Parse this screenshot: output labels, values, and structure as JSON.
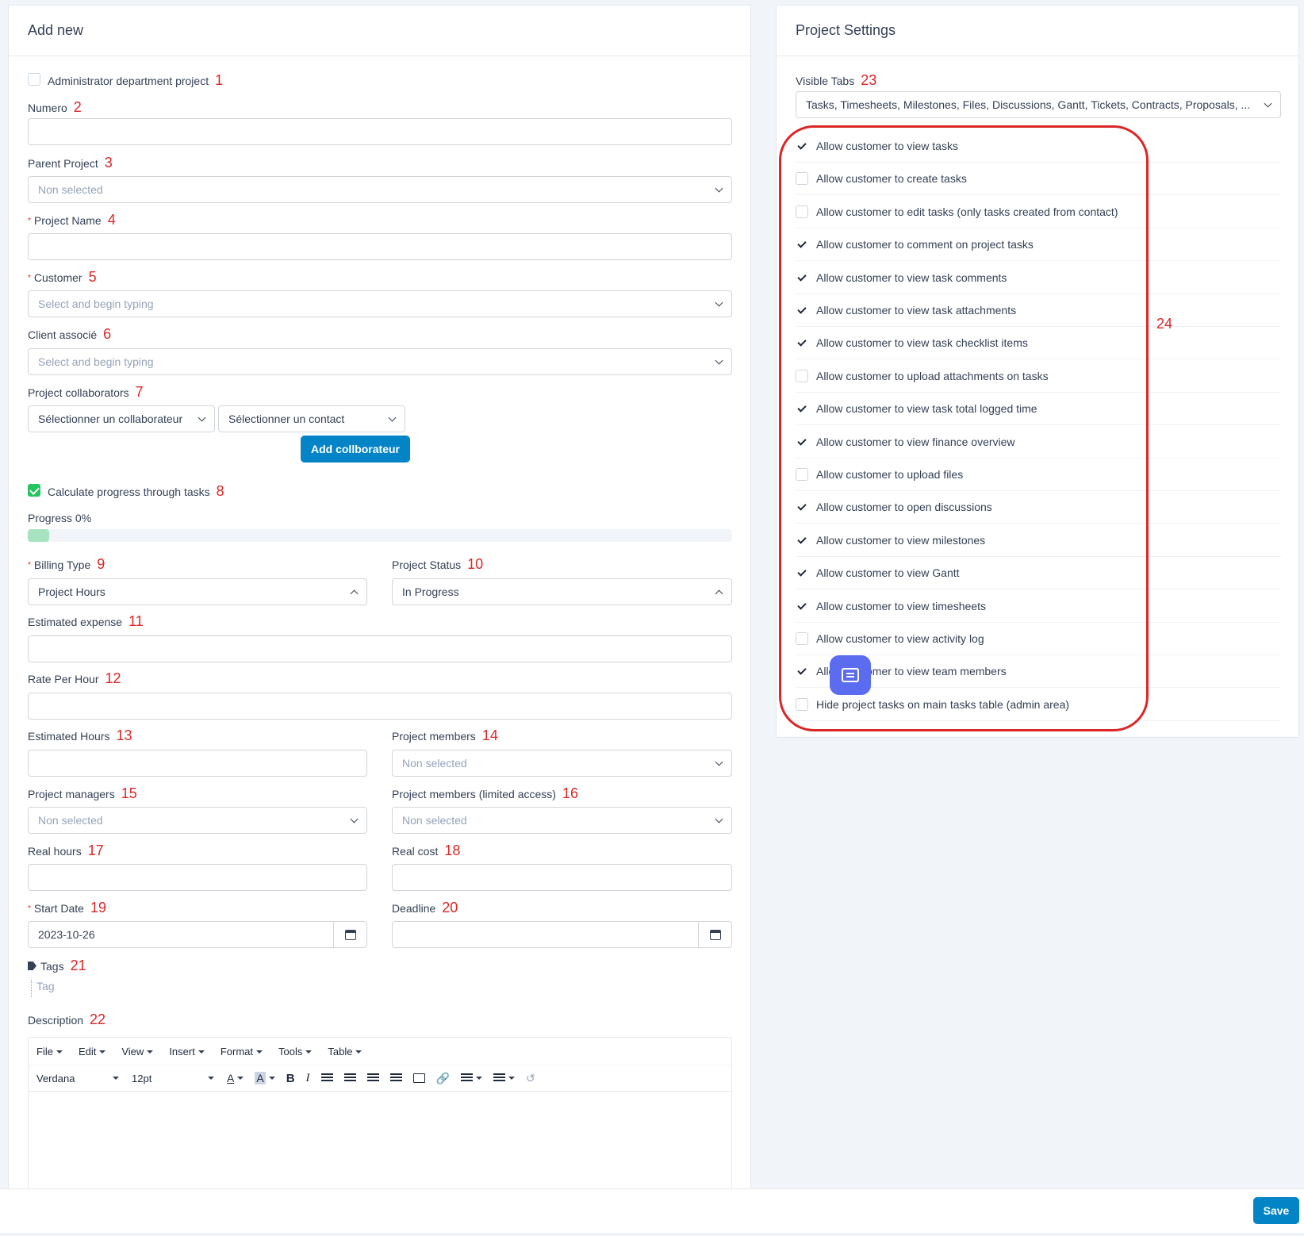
{
  "left": {
    "title": "Add new",
    "admin_dept": {
      "label": "Administrator department project",
      "anno": "1"
    },
    "numero": {
      "label": "Numero",
      "anno": "2",
      "value": ""
    },
    "parent_project": {
      "label": "Parent Project",
      "anno": "3",
      "placeholder": "Non selected"
    },
    "project_name": {
      "required": "*",
      "label": "Project Name",
      "anno": "4",
      "value": ""
    },
    "customer": {
      "required": "*",
      "label": "Customer",
      "anno": "5",
      "placeholder": "Select and begin typing"
    },
    "client_associe": {
      "label": "Client associé",
      "anno": "6",
      "placeholder": "Select and begin typing"
    },
    "collaborators": {
      "label": "Project collaborators",
      "anno": "7",
      "select_collab": "Sélectionner un collaborateur",
      "select_contact": "Sélectionner un contact",
      "add_button": "Add collborateur"
    },
    "calc_progress": {
      "label": "Calculate progress through tasks",
      "anno": "8",
      "checked": true
    },
    "progress": {
      "label": "Progress 0%",
      "value": 0.03
    },
    "billing_type": {
      "required": "*",
      "label": "Billing Type",
      "anno": "9",
      "value": "Project Hours"
    },
    "project_status": {
      "label": "Project Status",
      "anno": "10",
      "value": "In Progress"
    },
    "estimated_expense": {
      "label": "Estimated expense",
      "anno": "11",
      "value": ""
    },
    "rate_per_hour": {
      "label": "Rate Per Hour",
      "anno": "12",
      "value": ""
    },
    "estimated_hours": {
      "label": "Estimated Hours",
      "anno": "13",
      "value": ""
    },
    "project_members": {
      "label": "Project members",
      "anno": "14",
      "placeholder": "Non selected"
    },
    "project_managers": {
      "label": "Project managers",
      "anno": "15",
      "placeholder": "Non selected"
    },
    "project_members_limited": {
      "label": "Project members (limited access)",
      "anno": "16",
      "placeholder": "Non selected"
    },
    "real_hours": {
      "label": "Real hours",
      "anno": "17",
      "value": ""
    },
    "real_cost": {
      "label": "Real cost",
      "anno": "18",
      "value": ""
    },
    "start_date": {
      "required": "*",
      "label": "Start Date",
      "anno": "19",
      "value": "2023-10-26"
    },
    "deadline": {
      "label": "Deadline",
      "anno": "20",
      "value": ""
    },
    "tags": {
      "label": "Tags",
      "anno": "21",
      "placeholder": "Tag"
    },
    "description": {
      "label": "Description",
      "anno": "22"
    },
    "editor": {
      "menus": [
        "File",
        "Edit",
        "View",
        "Insert",
        "Format",
        "Tools",
        "Table"
      ],
      "font": "Verdana",
      "size": "12pt",
      "text_color": "A",
      "bg_color": "A",
      "bold": "B",
      "italic": "I"
    }
  },
  "right": {
    "title": "Project Settings",
    "visible_tabs": {
      "label": "Visible Tabs",
      "anno": "23",
      "value": "Tasks, Timesheets, Milestones, Files, Discussions, Gantt, Tickets, Contracts, Proposals, ..."
    },
    "group_anno": "24",
    "settings": [
      {
        "label": "Allow customer to view tasks",
        "checked": true
      },
      {
        "label": "Allow customer to create tasks",
        "checked": false
      },
      {
        "label": "Allow customer to edit tasks (only tasks created from contact)",
        "checked": false
      },
      {
        "label": "Allow customer to comment on project tasks",
        "checked": true
      },
      {
        "label": "Allow customer to view task comments",
        "checked": true
      },
      {
        "label": "Allow customer to view task attachments",
        "checked": true
      },
      {
        "label": "Allow customer to view task checklist items",
        "checked": true
      },
      {
        "label": "Allow customer to upload attachments on tasks",
        "checked": false
      },
      {
        "label": "Allow customer to view task total logged time",
        "checked": true
      },
      {
        "label": "Allow customer to view finance overview",
        "checked": true
      },
      {
        "label": "Allow customer to upload files",
        "checked": false
      },
      {
        "label": "Allow customer to open discussions",
        "checked": true
      },
      {
        "label": "Allow customer to view milestones",
        "checked": true
      },
      {
        "label": "Allow customer to view Gantt",
        "checked": true
      },
      {
        "label": "Allow customer to view timesheets",
        "checked": true
      },
      {
        "label": "Allow customer to view activity log",
        "checked": false
      },
      {
        "label": "Allow customer to view team members",
        "checked": true
      },
      {
        "label": "Hide project tasks on main tasks table (admin area)",
        "checked": false
      }
    ]
  },
  "footer": {
    "save_label": "Save"
  },
  "colors": {
    "primary": "#0284c7",
    "success": "#22c55e",
    "annotation": "#dc2626",
    "chat": "#5b6cf0"
  }
}
